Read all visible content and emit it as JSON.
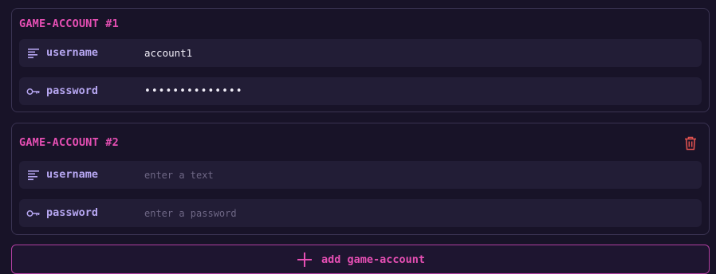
{
  "colors": {
    "background": "#181328",
    "accent": "#e64fb4",
    "label": "#b7a7f2",
    "danger": "#e0524f"
  },
  "accounts": [
    {
      "title": "GAME-ACCOUNT #1",
      "fields": [
        {
          "label": "username",
          "icon": "text-lines-icon",
          "value": "account1",
          "placeholder": "enter a text"
        },
        {
          "label": "password",
          "icon": "key-icon",
          "value": "••••••••••••••",
          "placeholder": "enter a password"
        }
      ]
    },
    {
      "title": "GAME-ACCOUNT #2",
      "delete_icon": "trash-icon",
      "fields": [
        {
          "label": "username",
          "icon": "text-lines-icon",
          "value": "",
          "placeholder": "enter a text"
        },
        {
          "label": "password",
          "icon": "key-icon",
          "value": "",
          "placeholder": "enter a password"
        }
      ]
    }
  ],
  "add_button": {
    "label": "add game-account",
    "icon": "plus-icon"
  }
}
